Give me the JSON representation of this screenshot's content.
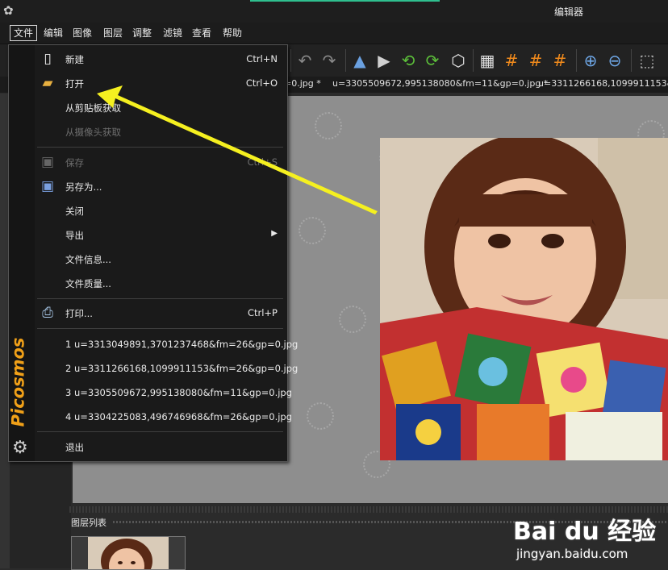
{
  "window": {
    "title": "编辑器"
  },
  "menubar": [
    "文件",
    "编辑",
    "图像",
    "图层",
    "调整",
    "滤镜",
    "查看",
    "帮助"
  ],
  "toolbar": {
    "icons": [
      "undo-icon",
      "redo-icon",
      "flip-vertical-icon",
      "flip-horizontal-icon",
      "rotate-left-icon",
      "rotate-right-icon",
      "rotate-free-icon",
      "grid-icon",
      "grid-orange-icon",
      "grid-orange2-icon",
      "grid-orange3-icon",
      "zoom-in-icon",
      "zoom-out-icon",
      "select-icon"
    ]
  },
  "tabs": [
    "=0.jpg *",
    "u=3305509672,995138080&fm=11&gp=0.jpg *",
    "u=3311266168,1099911153&fm"
  ],
  "file_menu": {
    "items": [
      {
        "label": "新建",
        "shortcut": "Ctrl+N",
        "icon": "new-file-icon"
      },
      {
        "label": "打开",
        "shortcut": "Ctrl+O",
        "icon": "open-folder-icon"
      },
      {
        "label": "从剪贴板获取",
        "shortcut": ""
      },
      {
        "label": "从摄像头获取",
        "shortcut": "",
        "disabled": true
      },
      {
        "label": "保存",
        "shortcut": "Ctrl+S",
        "disabled": true,
        "icon": "save-icon"
      },
      {
        "label": "另存为...",
        "shortcut": "",
        "icon": "save-as-icon"
      },
      {
        "label": "关闭",
        "shortcut": ""
      },
      {
        "label": "导出",
        "shortcut": "",
        "submenu": true
      },
      {
        "label": "文件信息...",
        "shortcut": ""
      },
      {
        "label": "文件质量...",
        "shortcut": ""
      },
      {
        "label": "打印...",
        "shortcut": "Ctrl+P",
        "icon": "printer-icon"
      },
      {
        "label": "1 u=3313049891,3701237468&fm=26&gp=0.jpg"
      },
      {
        "label": "2 u=3311266168,1099911153&fm=26&gp=0.jpg"
      },
      {
        "label": "3 u=3305509672,995138080&fm=11&gp=0.jpg"
      },
      {
        "label": "4 u=3304225083,496746968&fm=26&gp=0.jpg"
      },
      {
        "label": "退出"
      }
    ],
    "brand": "Picosmos"
  },
  "layers": {
    "label": "图层列表"
  },
  "watermark": {
    "logo": "Bai du 经验",
    "url": "jingyan.baidu.com"
  },
  "colors": {
    "accent": "#2fbf8f",
    "arrow": "#f5f020",
    "brand": "#f0a018",
    "menu_bg": "#1a1a1a"
  }
}
